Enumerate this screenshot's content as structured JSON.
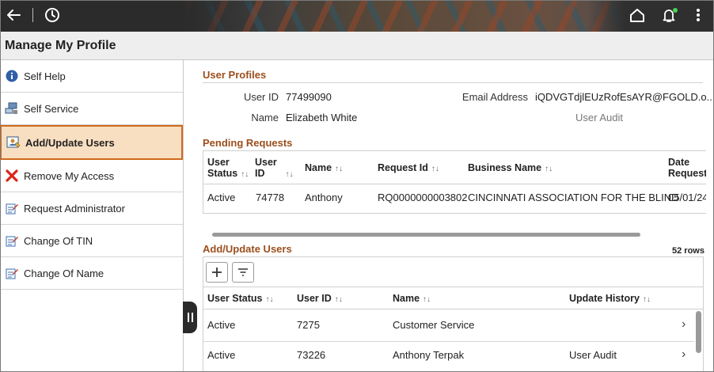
{
  "topbar": {
    "back_icon": "arrow-left-icon",
    "recent_icon": "clock-icon",
    "home_icon": "home-icon",
    "notifications_icon": "bell-icon",
    "more_icon": "vertical-dots-icon",
    "notification_dot_color": "#4bd25a"
  },
  "page": {
    "title": "Manage My Profile"
  },
  "sidebar": {
    "items": [
      {
        "label": "Self Help",
        "icon": "info-icon"
      },
      {
        "label": "Self Service",
        "icon": "self-service-icon"
      },
      {
        "label": "Add/Update Users",
        "icon": "user-edit-icon",
        "active": true
      },
      {
        "label": "Remove My Access",
        "icon": "red-x-icon"
      },
      {
        "label": "Request Administrator",
        "icon": "form-edit-icon"
      },
      {
        "label": "Change Of TIN",
        "icon": "form-edit-icon"
      },
      {
        "label": "Change Of Name",
        "icon": "form-edit-icon"
      }
    ],
    "active_color": "#f9dfc1",
    "active_border": "#d0691c"
  },
  "user_profiles": {
    "title": "User Profiles",
    "user_id_label": "User ID",
    "user_id_value": "77499090",
    "email_label": "Email Address",
    "email_value": "iQDVGTdjlEUzRofEsAYR@FGOLD.o...",
    "name_label": "Name",
    "name_value": "Elizabeth White",
    "user_audit_label": "User Audit"
  },
  "pending_requests": {
    "title": "Pending Requests",
    "columns": {
      "user_status": [
        "User",
        "Status"
      ],
      "user_id": [
        "User",
        "ID"
      ],
      "name": "Name",
      "request_id": "Request Id",
      "business_name": "Business Name",
      "date_requested": [
        "Date",
        "Request"
      ]
    },
    "rows": [
      {
        "user_status": "Active",
        "user_id": "74778",
        "name": "Anthony",
        "request_id": "RQ0000000003802",
        "business_name": "CINCINNATI ASSOCIATION FOR THE BLIND",
        "date_requested": "05/01/24"
      }
    ]
  },
  "add_update_users": {
    "title": "Add/Update Users",
    "row_count": "52 rows",
    "add_icon": "plus-icon",
    "filter_icon": "filter-icon",
    "columns": {
      "user_status": "User Status",
      "user_id": "User ID",
      "name": "Name",
      "update_history": "Update History"
    },
    "rows": [
      {
        "user_status": "Active",
        "user_id": "7275",
        "name": "Customer Service",
        "update_history": ""
      },
      {
        "user_status": "Active",
        "user_id": "73226",
        "name": "Anthony Terpak",
        "update_history": "User Audit"
      }
    ]
  },
  "colors": {
    "section_title": "#9b4f1c",
    "link": "#1f64a8"
  }
}
